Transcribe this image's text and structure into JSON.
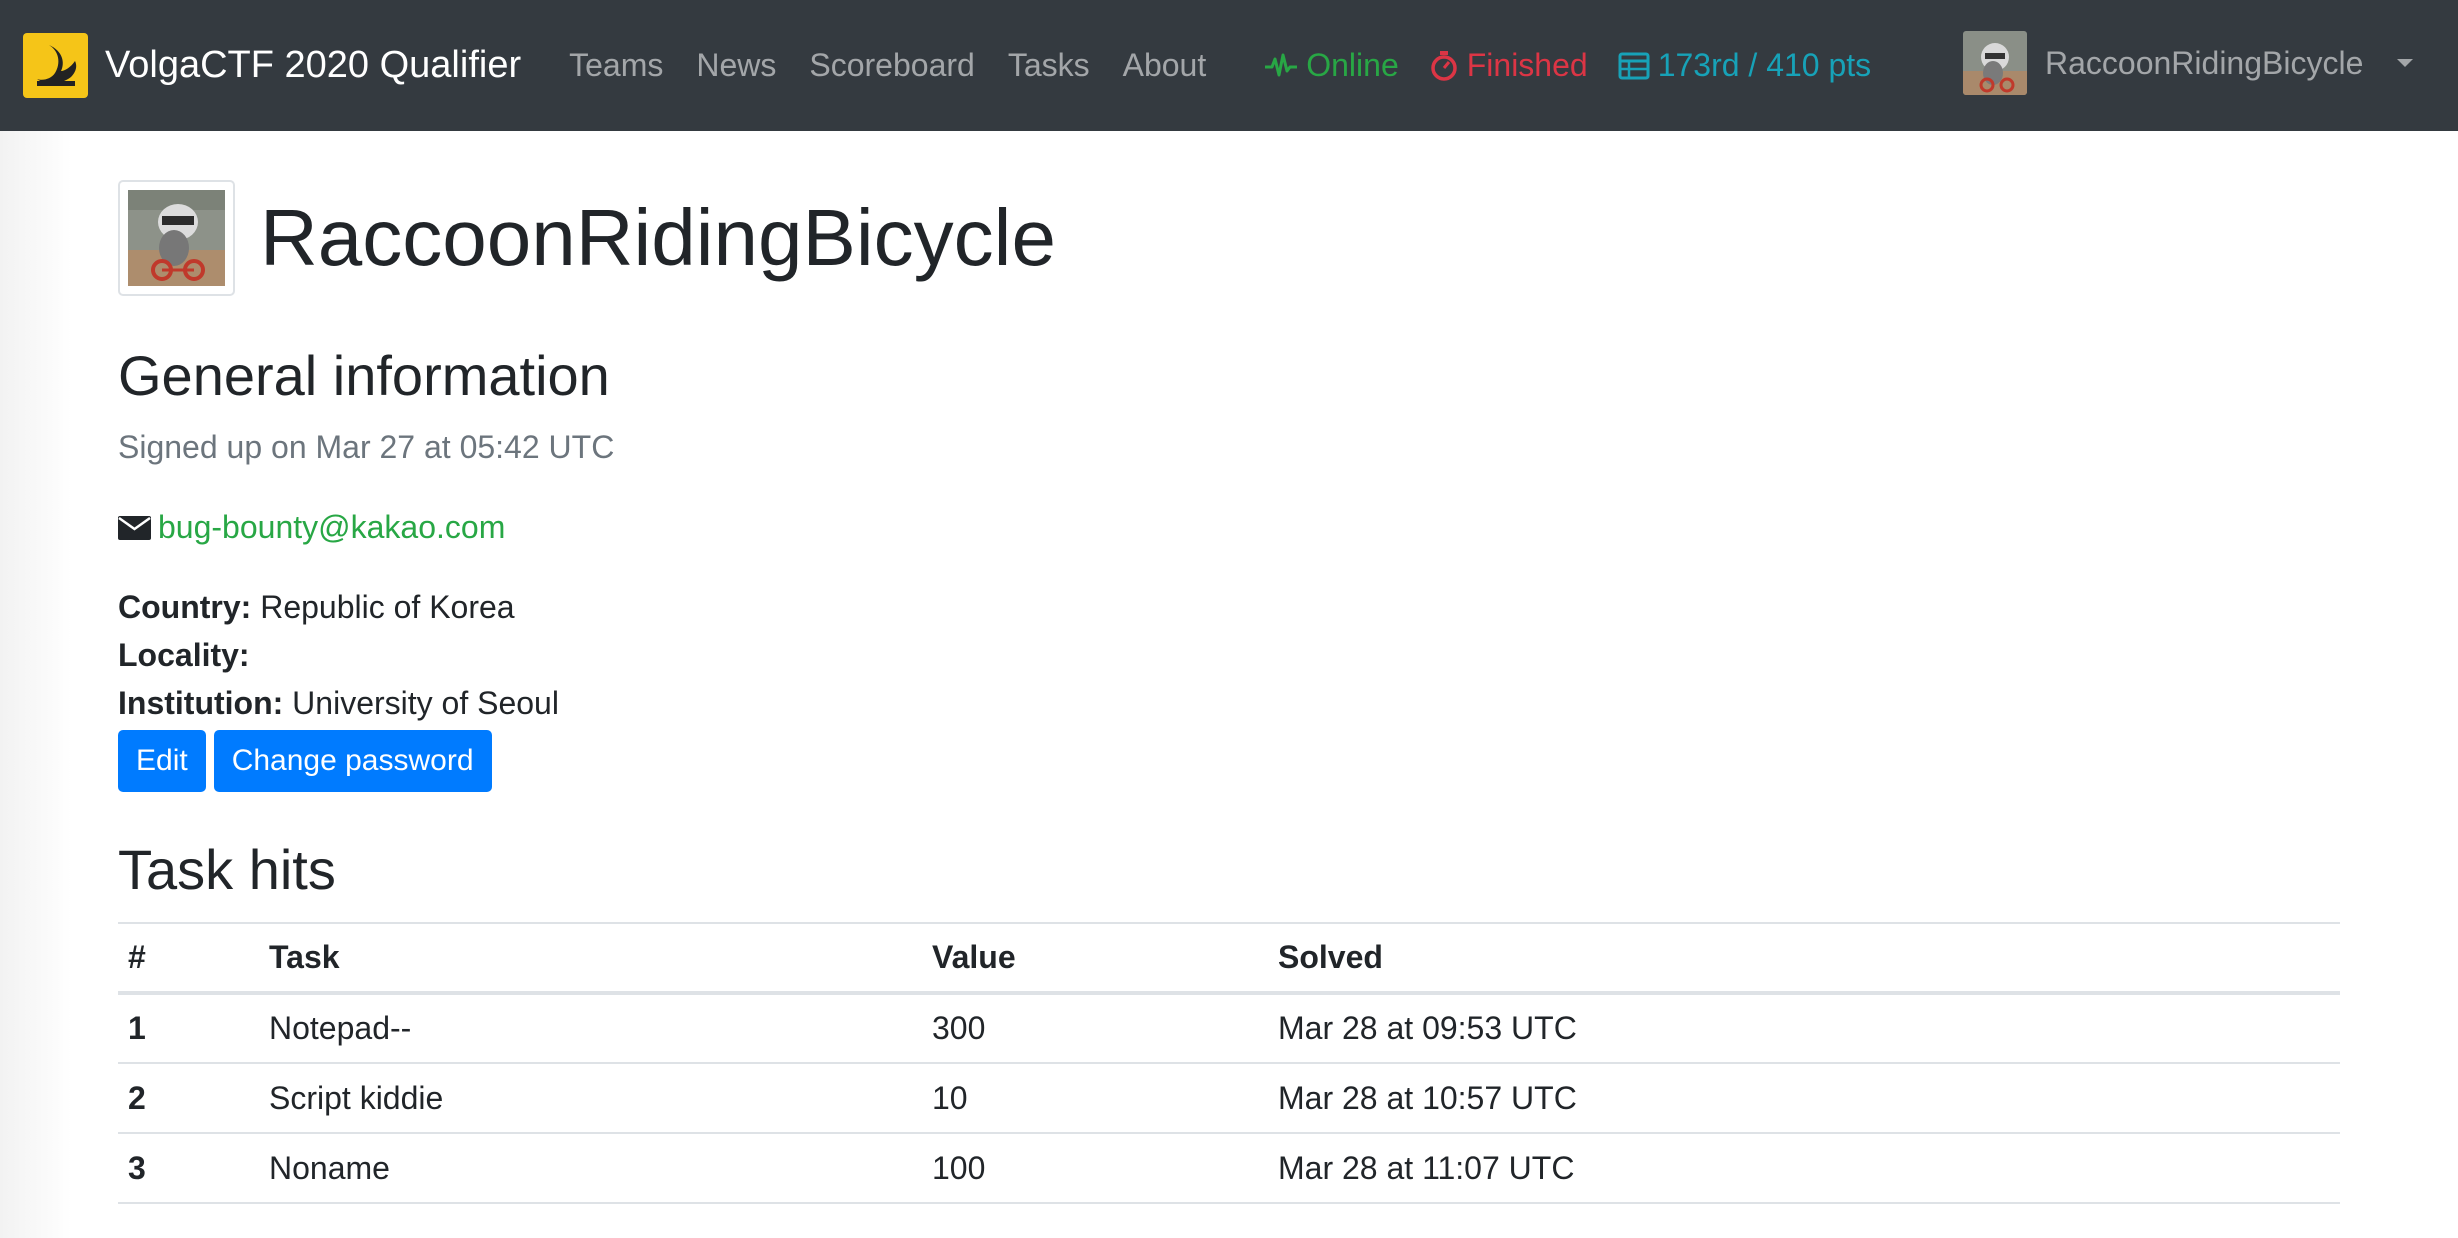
{
  "navbar": {
    "brand": "VolgaCTF 2020 Qualifier",
    "links": [
      "Teams",
      "News",
      "Scoreboard",
      "Tasks",
      "About"
    ],
    "status_online": "Online",
    "status_finished": "Finished",
    "rank_score": "173rd / 410 pts",
    "user_name": "RaccoonRidingBicycle",
    "colors": {
      "online": "#28a745",
      "finished": "#dc3545",
      "rank": "#17a2b8",
      "bg": "#343a40"
    }
  },
  "profile": {
    "team_name": "RaccoonRidingBicycle",
    "general_heading": "General information",
    "signed_up": "Signed up on Mar 27 at 05:42 UTC",
    "email": "bug-bounty@kakao.com",
    "country_label": "Country:",
    "country": "Republic of Korea",
    "locality_label": "Locality:",
    "locality": "",
    "institution_label": "Institution:",
    "institution": "University of Seoul",
    "edit_label": "Edit",
    "change_password_label": "Change password"
  },
  "task_hits": {
    "heading": "Task hits",
    "columns": [
      "#",
      "Task",
      "Value",
      "Solved"
    ],
    "rows": [
      {
        "num": "1",
        "task": "Notepad--",
        "value": "300",
        "solved": "Mar 28 at 09:53 UTC"
      },
      {
        "num": "2",
        "task": "Script kiddie",
        "value": "10",
        "solved": "Mar 28 at 10:57 UTC"
      },
      {
        "num": "3",
        "task": "Noname",
        "value": "100",
        "solved": "Mar 28 at 11:07 UTC"
      }
    ]
  },
  "icons": {
    "brand": "volgactf-logo",
    "online": "heartbeat-icon",
    "finished": "stopwatch-icon",
    "rank": "table-icon",
    "email": "envelope-icon",
    "dropdown": "caret-down-icon"
  }
}
